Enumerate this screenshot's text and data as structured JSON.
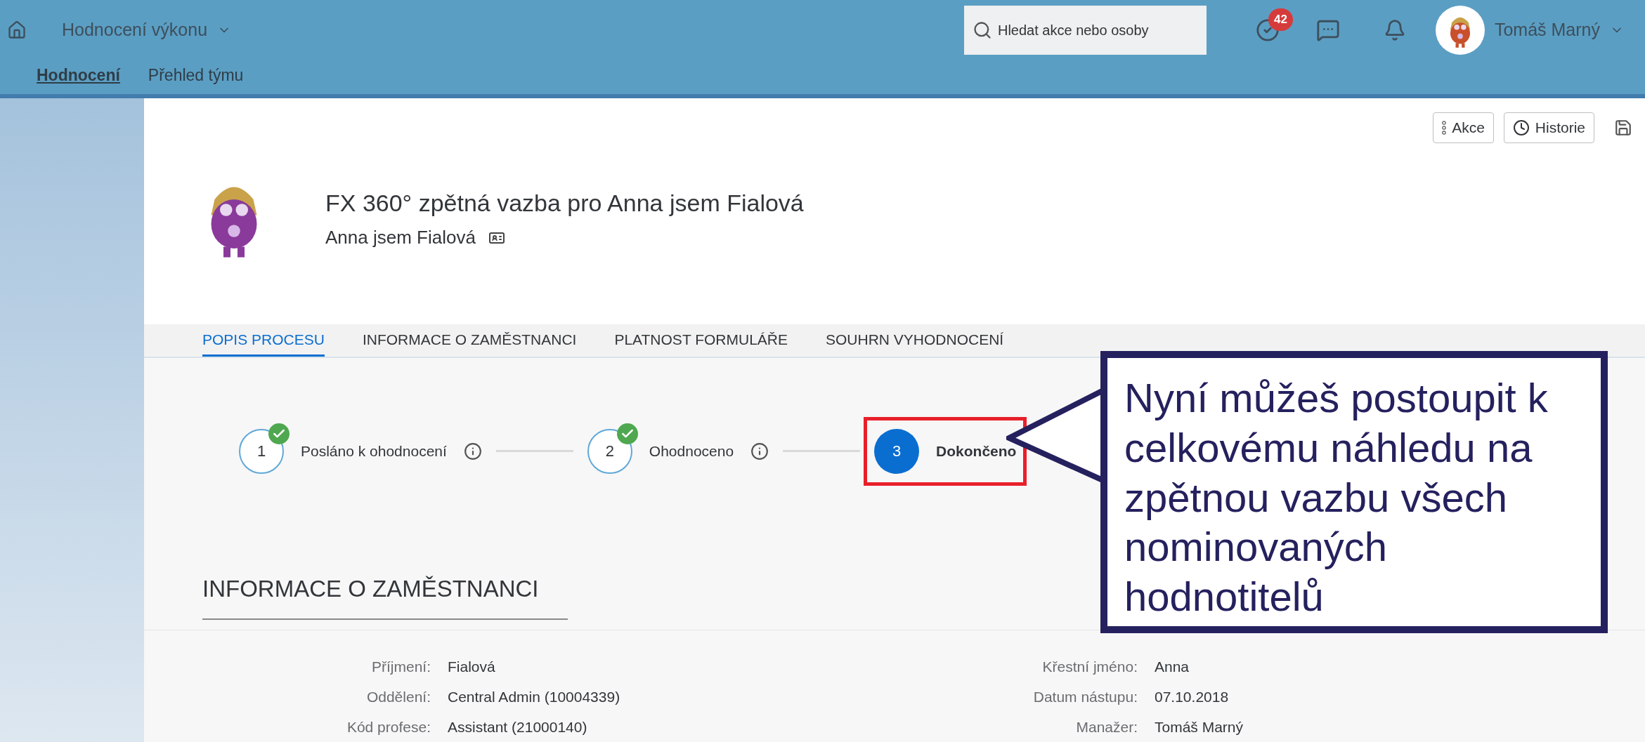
{
  "shell": {
    "app_title": "Hodnocení výkonu",
    "nav": [
      {
        "label": "Hodnocení",
        "selected": true
      },
      {
        "label": "Přehled týmu",
        "selected": false
      }
    ],
    "search": {
      "placeholder": "Hledat akce nebo osoby"
    },
    "tasks_badge": "42",
    "user_name": "Tomáš Marný"
  },
  "actions": [
    "Akce",
    "Historie"
  ],
  "header": {
    "title": "FX 360° zpětná vazba pro Anna jsem Fialová",
    "subtitle": "Anna jsem Fialová"
  },
  "tabs": [
    {
      "label": "POPIS PROCESU",
      "selected": true
    },
    {
      "label": "INFORMACE O ZAMĚSTNANCI",
      "selected": false
    },
    {
      "label": "PLATNOST FORMULÁŘE",
      "selected": false
    },
    {
      "label": "SOUHRN VYHODNOCENÍ",
      "selected": false
    }
  ],
  "steps": [
    {
      "number": "1",
      "label": "Posláno k ohodnocení",
      "done": true,
      "highlighted": false
    },
    {
      "number": "2",
      "label": "Ohodnoceno",
      "done": true,
      "highlighted": false
    },
    {
      "number": "3",
      "label": "Dokončeno",
      "done": false,
      "highlighted": true
    }
  ],
  "callout": {
    "text": "Nyní můžeš postoupit k celkovému náhledu na zpětnou vazbu všech nominovaných hodnotitelů"
  },
  "section": {
    "title": "INFORMACE O ZAMĚSTNANCI",
    "left": [
      {
        "label": "Příjmení:",
        "value": "Fialová"
      },
      {
        "label": "Oddělení:",
        "value": "Central Admin (10004339)"
      },
      {
        "label": "Kód profese:",
        "value": "Assistant (21000140)"
      }
    ],
    "right": [
      {
        "label": "Křestní jméno:",
        "value": "Anna"
      },
      {
        "label": "Datum nástupu:",
        "value": "07.10.2018"
      },
      {
        "label": "Manažer:",
        "value": "Tomáš Marný"
      }
    ]
  }
}
